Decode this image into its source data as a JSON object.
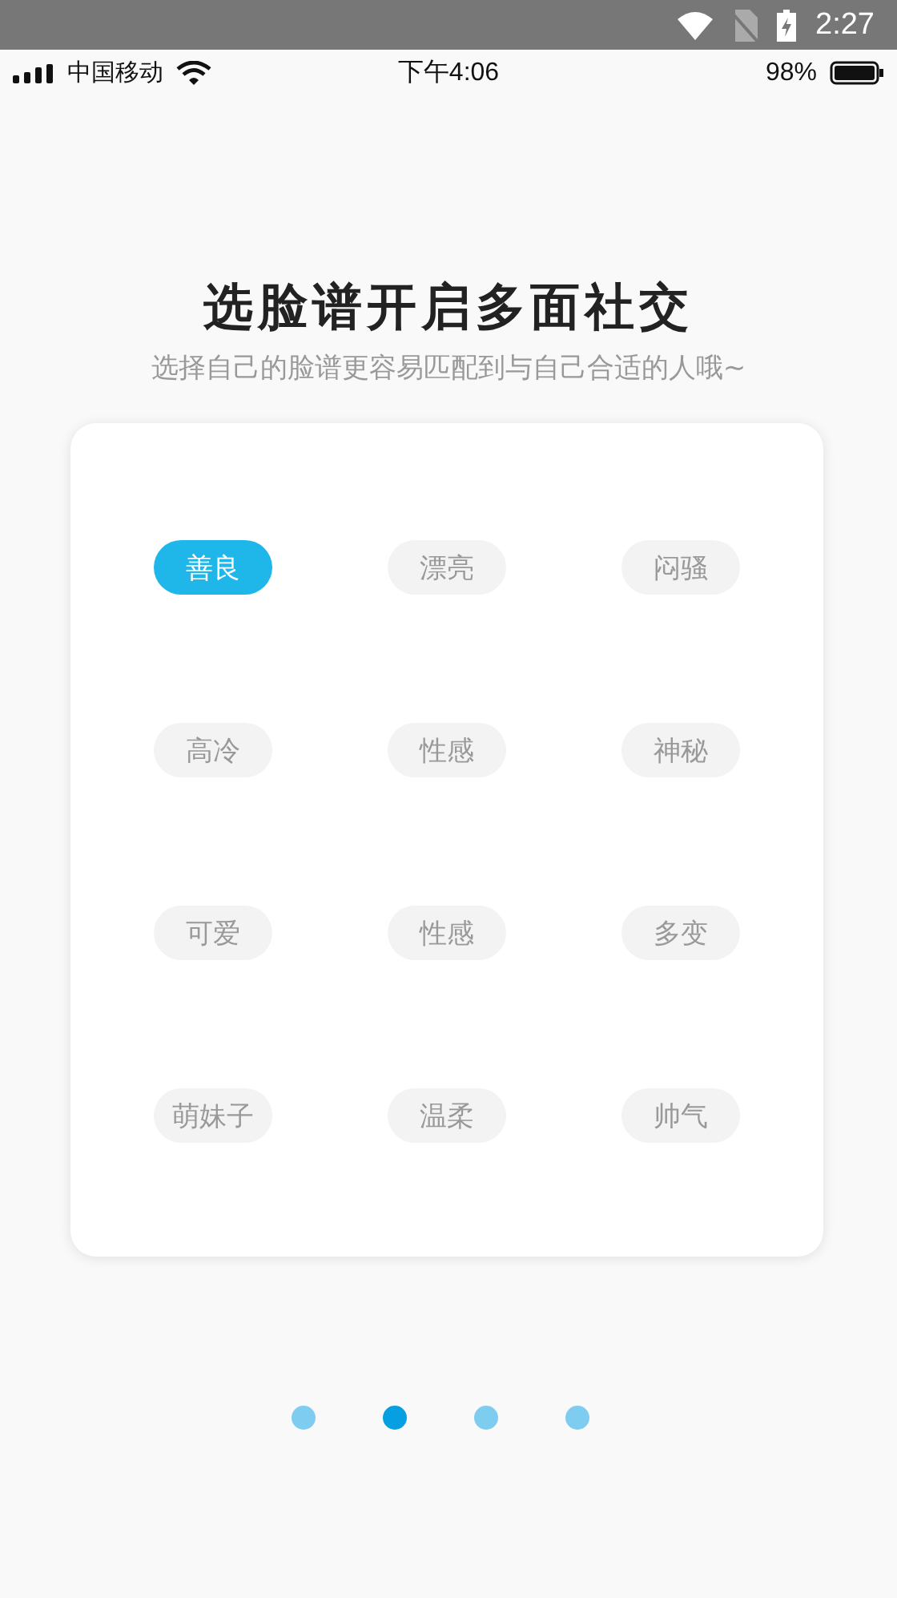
{
  "system_bar": {
    "time": "2:27"
  },
  "status_bar": {
    "carrier": "中国移动",
    "time": "下午4:06",
    "battery": "98%"
  },
  "title": "选脸谱开启多面社交",
  "subtitle": "选择自己的脸谱更容易匹配到与自己合适的人哦~",
  "tags": [
    {
      "label": "善良",
      "selected": true
    },
    {
      "label": "漂亮",
      "selected": false
    },
    {
      "label": "闷骚",
      "selected": false
    },
    {
      "label": "高冷",
      "selected": false
    },
    {
      "label": "性感",
      "selected": false
    },
    {
      "label": "神秘",
      "selected": false
    },
    {
      "label": "可爱",
      "selected": false
    },
    {
      "label": "性感",
      "selected": false
    },
    {
      "label": "多变",
      "selected": false
    },
    {
      "label": "萌妹子",
      "selected": false
    },
    {
      "label": "温柔",
      "selected": false
    },
    {
      "label": "帅气",
      "selected": false
    }
  ],
  "pages": [
    {
      "selected": false
    },
    {
      "selected": true
    },
    {
      "selected": false
    },
    {
      "selected": false
    }
  ]
}
